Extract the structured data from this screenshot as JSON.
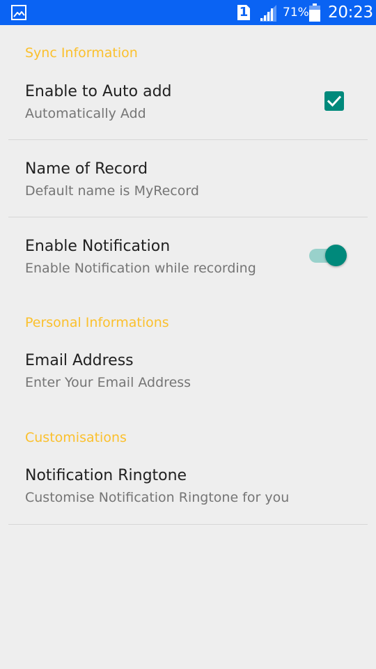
{
  "status_bar": {
    "sim_label": "1",
    "battery_percent": "71%",
    "time": "20:23",
    "icons": [
      "gallery-icon",
      "sim-icon",
      "signal-icon",
      "battery-icon"
    ]
  },
  "sections": {
    "sync": {
      "header": "Sync Information",
      "auto_add": {
        "title": "Enable to Auto add",
        "summary": "Automatically Add",
        "checked": true
      },
      "record_name": {
        "title": "Name of Record",
        "summary": "Default name is MyRecord"
      },
      "notification": {
        "title": "Enable Notification",
        "summary": "Enable Notification while recording",
        "enabled": true
      }
    },
    "personal": {
      "header": "Personal Informations",
      "email": {
        "title": "Email Address",
        "summary": "Enter Your Email Address"
      }
    },
    "custom": {
      "header": "Customisations",
      "ringtone": {
        "title": "Notification Ringtone",
        "summary": "Customise Notification Ringtone for you"
      }
    }
  },
  "colors": {
    "status_bar": "#0A63F3",
    "background": "#EEEEEE",
    "section_header": "#FBC02D",
    "accent": "#00897B",
    "switch_track": "#99D1CB",
    "title_text": "#212121",
    "summary_text": "#757575"
  }
}
